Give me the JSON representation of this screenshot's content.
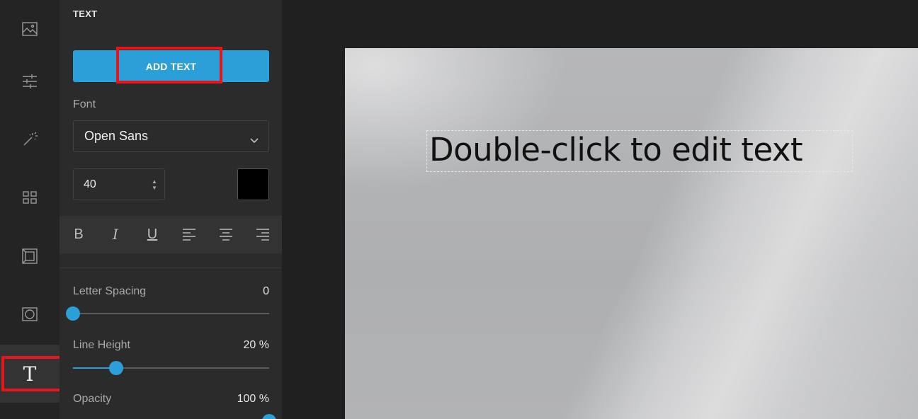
{
  "rail": {
    "items": [
      {
        "icon": "image-icon"
      },
      {
        "icon": "adjustments-icon"
      },
      {
        "icon": "magic-wand-icon"
      },
      {
        "icon": "grid-icon"
      },
      {
        "icon": "frame-icon"
      },
      {
        "icon": "vignette-icon"
      },
      {
        "icon": "text-icon",
        "glyph": "T",
        "active": true
      }
    ]
  },
  "panel": {
    "title": "TEXT",
    "add_button": "ADD TEXT",
    "font_label": "Font",
    "font_value": "Open Sans",
    "size_value": "40",
    "color_value": "#000000",
    "format_buttons": [
      "bold-icon",
      "italic-icon",
      "underline-icon",
      "align-left-icon",
      "align-center-icon",
      "align-right-icon"
    ],
    "format_glyphs": {
      "bold": "B",
      "italic": "I",
      "underline": "U"
    },
    "letter_spacing": {
      "label": "Letter Spacing",
      "value": "0",
      "fraction": 0.0
    },
    "line_height": {
      "label": "Line Height",
      "value": "20 %",
      "fraction": 0.22
    },
    "opacity": {
      "label": "Opacity",
      "value": "100 %",
      "fraction": 1.0
    }
  },
  "canvas": {
    "placeholder_text": "Double-click to edit text"
  },
  "colors": {
    "accent": "#2a9fd8",
    "highlight": "#e8141b",
    "panel_bg": "#2b2b2b"
  }
}
